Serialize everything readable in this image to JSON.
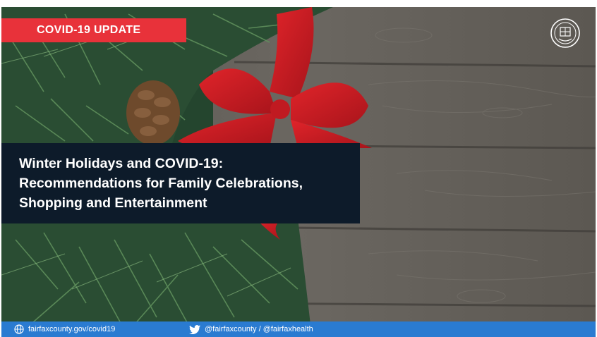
{
  "banner": {
    "badge": "COVID-19 UPDATE",
    "headline_lines": [
      "Winter Holidays and COVID-19:",
      "Recommendations for Family Celebrations,",
      "Shopping and Entertainment"
    ]
  },
  "footer": {
    "website": "fairfaxcounty.gov/covid19",
    "social": "@fairfaxcounty / @fairfaxhealth"
  },
  "colors": {
    "badge": "#e8323a",
    "headline_bg": "#0d1b2a",
    "footer_bg": "#2a7bd1"
  },
  "icons": [
    "globe-icon",
    "twitter-bird-icon",
    "county-seal-icon"
  ]
}
